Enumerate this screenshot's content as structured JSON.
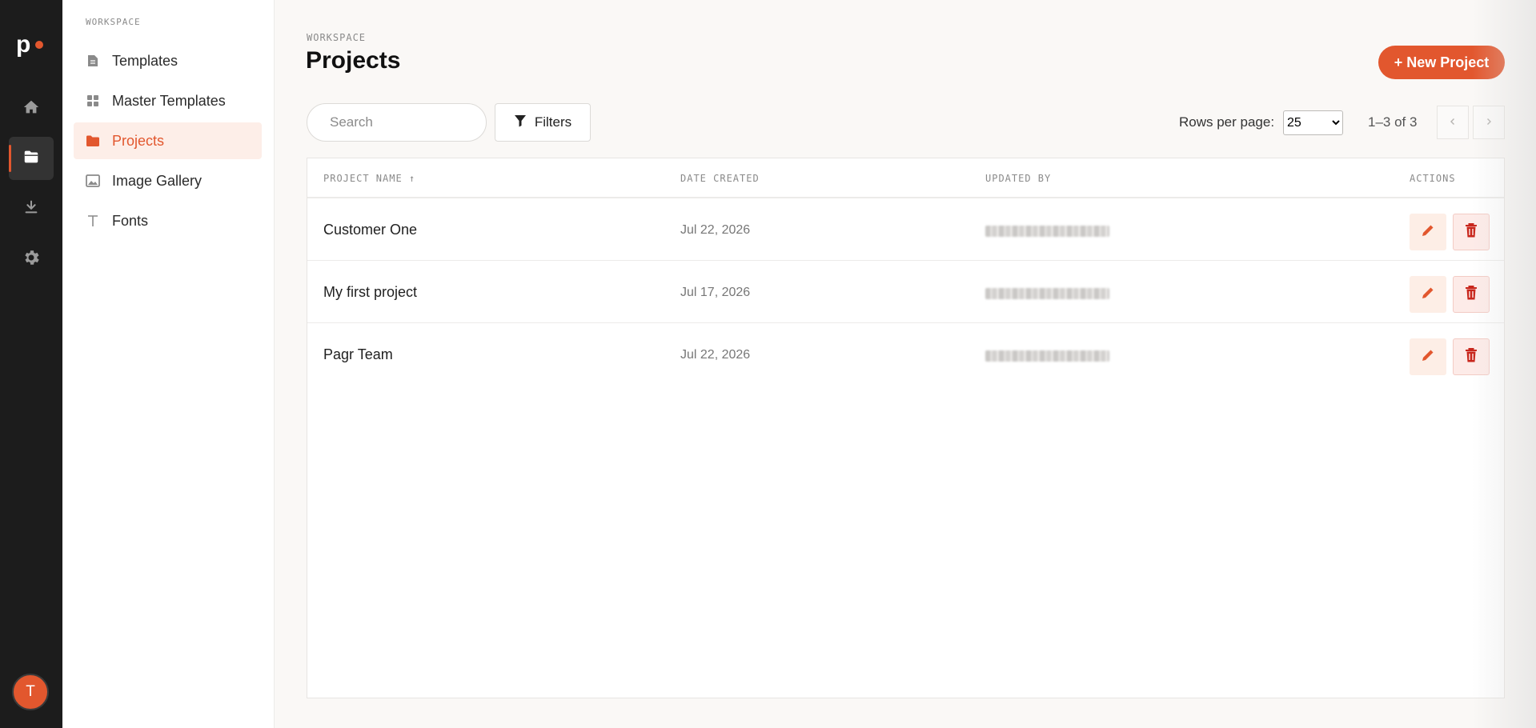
{
  "brand": {
    "logo_letter": "p",
    "accent": "#e2572e"
  },
  "rail": {
    "items": [
      {
        "icon": "home-icon"
      },
      {
        "icon": "folder-icon",
        "active": true
      },
      {
        "icon": "download-icon"
      },
      {
        "icon": "gear-icon"
      }
    ],
    "avatar_initial": "T"
  },
  "subnav": {
    "heading": "WORKSPACE",
    "items": [
      {
        "label": "Templates",
        "icon": "document-icon"
      },
      {
        "label": "Master Templates",
        "icon": "grid-icon"
      },
      {
        "label": "Projects",
        "icon": "folder-icon",
        "active": true
      },
      {
        "label": "Image Gallery",
        "icon": "image-icon"
      },
      {
        "label": "Fonts",
        "icon": "font-icon"
      }
    ]
  },
  "header": {
    "breadcrumb": "WORKSPACE",
    "title": "Projects",
    "new_button": "+ New Project"
  },
  "toolbar": {
    "search_placeholder": "Search",
    "filters_label": "Filters",
    "rows_label": "Rows per page:",
    "rows_value": "25",
    "range": "1–3 of 3"
  },
  "table": {
    "columns": {
      "name": "PROJECT NAME",
      "name_sort": "↑",
      "date": "DATE CREATED",
      "updated": "UPDATED BY",
      "actions": "ACTIONS"
    },
    "rows": [
      {
        "name": "Customer One",
        "date": "Jul 22, 2026",
        "updated_by": "redacted"
      },
      {
        "name": "My first project",
        "date": "Jul 17, 2026",
        "updated_by": "redacted"
      },
      {
        "name": "Pagr Team",
        "date": "Jul 22, 2026",
        "updated_by": "redacted"
      }
    ]
  }
}
